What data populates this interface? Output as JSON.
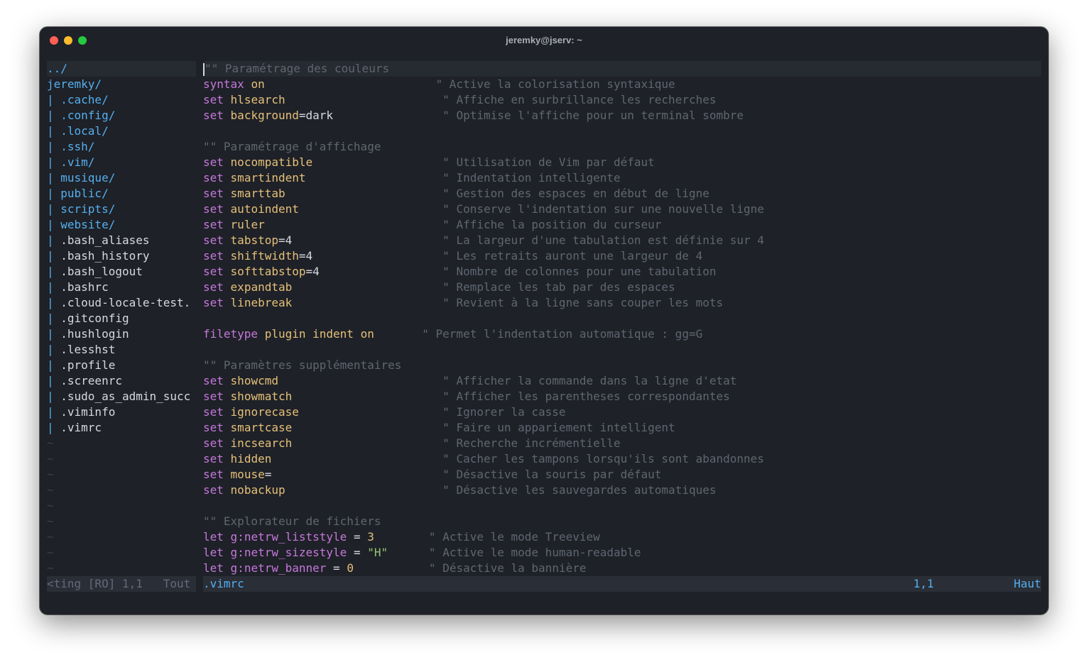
{
  "window": {
    "title": "jeremky@jserv: ~"
  },
  "tree": {
    "updir": "../",
    "root": "jeremky/",
    "entries": [
      {
        "name": ".cache/",
        "dir": true
      },
      {
        "name": ".config/",
        "dir": true
      },
      {
        "name": ".local/",
        "dir": true
      },
      {
        "name": ".ssh/",
        "dir": true
      },
      {
        "name": ".vim/",
        "dir": true
      },
      {
        "name": "musique/",
        "dir": true
      },
      {
        "name": "public/",
        "dir": true
      },
      {
        "name": "scripts/",
        "dir": true
      },
      {
        "name": "website/",
        "dir": true
      },
      {
        "name": ".bash_aliases",
        "dir": false
      },
      {
        "name": ".bash_history",
        "dir": false
      },
      {
        "name": ".bash_logout",
        "dir": false
      },
      {
        "name": ".bashrc",
        "dir": false
      },
      {
        "name": ".cloud-locale-test.",
        "dir": false
      },
      {
        "name": ".gitconfig",
        "dir": false
      },
      {
        "name": ".hushlogin",
        "dir": false
      },
      {
        "name": ".lesshst",
        "dir": false
      },
      {
        "name": ".profile",
        "dir": false
      },
      {
        "name": ".screenrc",
        "dir": false
      },
      {
        "name": ".sudo_as_admin_succ",
        "dir": false
      },
      {
        "name": ".viminfo",
        "dir": false
      },
      {
        "name": ".vimrc",
        "dir": false
      }
    ],
    "tilde_rows": 9
  },
  "editor": {
    "lines": [
      [
        {
          "t": "\"\" Paramétrage des couleurs",
          "c": "cmt"
        }
      ],
      [
        {
          "t": "syntax",
          "c": "kw"
        },
        {
          "t": " "
        },
        {
          "t": "on",
          "c": "opt"
        },
        {
          "t": "                         "
        },
        {
          "t": "\" Active la colorisation syntaxique",
          "c": "cmt"
        }
      ],
      [
        {
          "t": "set",
          "c": "kw"
        },
        {
          "t": " "
        },
        {
          "t": "hlsearch",
          "c": "opt"
        },
        {
          "t": "                       "
        },
        {
          "t": "\" Affiche en surbrillance les recherches",
          "c": "cmt"
        }
      ],
      [
        {
          "t": "set",
          "c": "kw"
        },
        {
          "t": " "
        },
        {
          "t": "background",
          "c": "opt"
        },
        {
          "t": "=dark",
          "c": "val"
        },
        {
          "t": "                "
        },
        {
          "t": "\" Optimise l'affiche pour un terminal sombre",
          "c": "cmt"
        }
      ],
      [],
      [
        {
          "t": "\"\" Paramétrage d'affichage",
          "c": "cmt"
        }
      ],
      [
        {
          "t": "set",
          "c": "kw"
        },
        {
          "t": " "
        },
        {
          "t": "nocompatible",
          "c": "opt"
        },
        {
          "t": "                   "
        },
        {
          "t": "\" Utilisation de Vim par défaut",
          "c": "cmt"
        }
      ],
      [
        {
          "t": "set",
          "c": "kw"
        },
        {
          "t": " "
        },
        {
          "t": "smartindent",
          "c": "opt"
        },
        {
          "t": "                    "
        },
        {
          "t": "\" Indentation intelligente",
          "c": "cmt"
        }
      ],
      [
        {
          "t": "set",
          "c": "kw"
        },
        {
          "t": " "
        },
        {
          "t": "smarttab",
          "c": "opt"
        },
        {
          "t": "                       "
        },
        {
          "t": "\" Gestion des espaces en début de ligne",
          "c": "cmt"
        }
      ],
      [
        {
          "t": "set",
          "c": "kw"
        },
        {
          "t": " "
        },
        {
          "t": "autoindent",
          "c": "opt"
        },
        {
          "t": "                     "
        },
        {
          "t": "\" Conserve l'indentation sur une nouvelle ligne",
          "c": "cmt"
        }
      ],
      [
        {
          "t": "set",
          "c": "kw"
        },
        {
          "t": " "
        },
        {
          "t": "ruler",
          "c": "opt"
        },
        {
          "t": "                          "
        },
        {
          "t": "\" Affiche la position du curseur",
          "c": "cmt"
        }
      ],
      [
        {
          "t": "set",
          "c": "kw"
        },
        {
          "t": " "
        },
        {
          "t": "tabstop",
          "c": "opt"
        },
        {
          "t": "=4",
          "c": "val"
        },
        {
          "t": "                      "
        },
        {
          "t": "\" La largeur d'une tabulation est définie sur 4",
          "c": "cmt"
        }
      ],
      [
        {
          "t": "set",
          "c": "kw"
        },
        {
          "t": " "
        },
        {
          "t": "shiftwidth",
          "c": "opt"
        },
        {
          "t": "=4",
          "c": "val"
        },
        {
          "t": "                   "
        },
        {
          "t": "\" Les retraits auront une largeur de 4",
          "c": "cmt"
        }
      ],
      [
        {
          "t": "set",
          "c": "kw"
        },
        {
          "t": " "
        },
        {
          "t": "softtabstop",
          "c": "opt"
        },
        {
          "t": "=4",
          "c": "val"
        },
        {
          "t": "                  "
        },
        {
          "t": "\" Nombre de colonnes pour une tabulation",
          "c": "cmt"
        }
      ],
      [
        {
          "t": "set",
          "c": "kw"
        },
        {
          "t": " "
        },
        {
          "t": "expandtab",
          "c": "opt"
        },
        {
          "t": "                      "
        },
        {
          "t": "\" Remplace les tab par des espaces",
          "c": "cmt"
        }
      ],
      [
        {
          "t": "set",
          "c": "kw"
        },
        {
          "t": " "
        },
        {
          "t": "linebreak",
          "c": "opt"
        },
        {
          "t": "                      "
        },
        {
          "t": "\" Revient à la ligne sans couper les mots",
          "c": "cmt"
        }
      ],
      [],
      [
        {
          "t": "filetype",
          "c": "kw"
        },
        {
          "t": " "
        },
        {
          "t": "plugin indent on",
          "c": "opt"
        },
        {
          "t": "       "
        },
        {
          "t": "\" Permet l'indentation automatique : gg=G",
          "c": "cmt"
        }
      ],
      [],
      [
        {
          "t": "\"\" Paramètres supplémentaires",
          "c": "cmt"
        }
      ],
      [
        {
          "t": "set",
          "c": "kw"
        },
        {
          "t": " "
        },
        {
          "t": "showcmd",
          "c": "opt"
        },
        {
          "t": "                        "
        },
        {
          "t": "\" Afficher la commande dans la ligne d'etat",
          "c": "cmt"
        }
      ],
      [
        {
          "t": "set",
          "c": "kw"
        },
        {
          "t": " "
        },
        {
          "t": "showmatch",
          "c": "opt"
        },
        {
          "t": "                      "
        },
        {
          "t": "\" Afficher les parentheses correspondantes",
          "c": "cmt"
        }
      ],
      [
        {
          "t": "set",
          "c": "kw"
        },
        {
          "t": " "
        },
        {
          "t": "ignorecase",
          "c": "opt"
        },
        {
          "t": "                     "
        },
        {
          "t": "\" Ignorer la casse",
          "c": "cmt"
        }
      ],
      [
        {
          "t": "set",
          "c": "kw"
        },
        {
          "t": " "
        },
        {
          "t": "smartcase",
          "c": "opt"
        },
        {
          "t": "                      "
        },
        {
          "t": "\" Faire un appariement intelligent",
          "c": "cmt"
        }
      ],
      [
        {
          "t": "set",
          "c": "kw"
        },
        {
          "t": " "
        },
        {
          "t": "incsearch",
          "c": "opt"
        },
        {
          "t": "                      "
        },
        {
          "t": "\" Recherche incrémentielle",
          "c": "cmt"
        }
      ],
      [
        {
          "t": "set",
          "c": "kw"
        },
        {
          "t": " "
        },
        {
          "t": "hidden",
          "c": "opt"
        },
        {
          "t": "                         "
        },
        {
          "t": "\" Cacher les tampons lorsqu'ils sont abandonnes",
          "c": "cmt"
        }
      ],
      [
        {
          "t": "set",
          "c": "kw"
        },
        {
          "t": " "
        },
        {
          "t": "mouse",
          "c": "opt"
        },
        {
          "t": "=",
          "c": "val"
        },
        {
          "t": "                         "
        },
        {
          "t": "\" Désactive la souris par défaut",
          "c": "cmt"
        }
      ],
      [
        {
          "t": "set",
          "c": "kw"
        },
        {
          "t": " "
        },
        {
          "t": "nobackup",
          "c": "opt"
        },
        {
          "t": "                       "
        },
        {
          "t": "\" Désactive les sauvegardes automatiques",
          "c": "cmt"
        }
      ],
      [],
      [
        {
          "t": "\"\" Explorateur de fichiers",
          "c": "cmt"
        }
      ],
      [
        {
          "t": "let",
          "c": "kw"
        },
        {
          "t": " "
        },
        {
          "t": "g:netrw_liststyle",
          "c": "kw"
        },
        {
          "t": " = ",
          "c": "val"
        },
        {
          "t": "3",
          "c": "num"
        },
        {
          "t": "        "
        },
        {
          "t": "\" Active le mode Treeview",
          "c": "cmt"
        }
      ],
      [
        {
          "t": "let",
          "c": "kw"
        },
        {
          "t": " "
        },
        {
          "t": "g:netrw_sizestyle",
          "c": "kw"
        },
        {
          "t": " = ",
          "c": "val"
        },
        {
          "t": "\"H\"",
          "c": "str"
        },
        {
          "t": "      "
        },
        {
          "t": "\" Active le mode human-readable",
          "c": "cmt"
        }
      ],
      [
        {
          "t": "let",
          "c": "kw"
        },
        {
          "t": " "
        },
        {
          "t": "g:netrw_banner",
          "c": "kw"
        },
        {
          "t": " = ",
          "c": "val"
        },
        {
          "t": "0",
          "c": "num"
        },
        {
          "t": "           "
        },
        {
          "t": "\" Désactive la bannière",
          "c": "cmt"
        }
      ]
    ]
  },
  "status": {
    "left": "<ting [RO] 1,1   Tout",
    "file": ".vimrc",
    "position": "1,1",
    "scroll": "Haut"
  },
  "colors": {
    "background": "#1e2127",
    "directory": "#55aff0",
    "keyword": "#c678dd",
    "option": "#e5c07b",
    "string": "#98c379",
    "comment": "#5f6672"
  }
}
